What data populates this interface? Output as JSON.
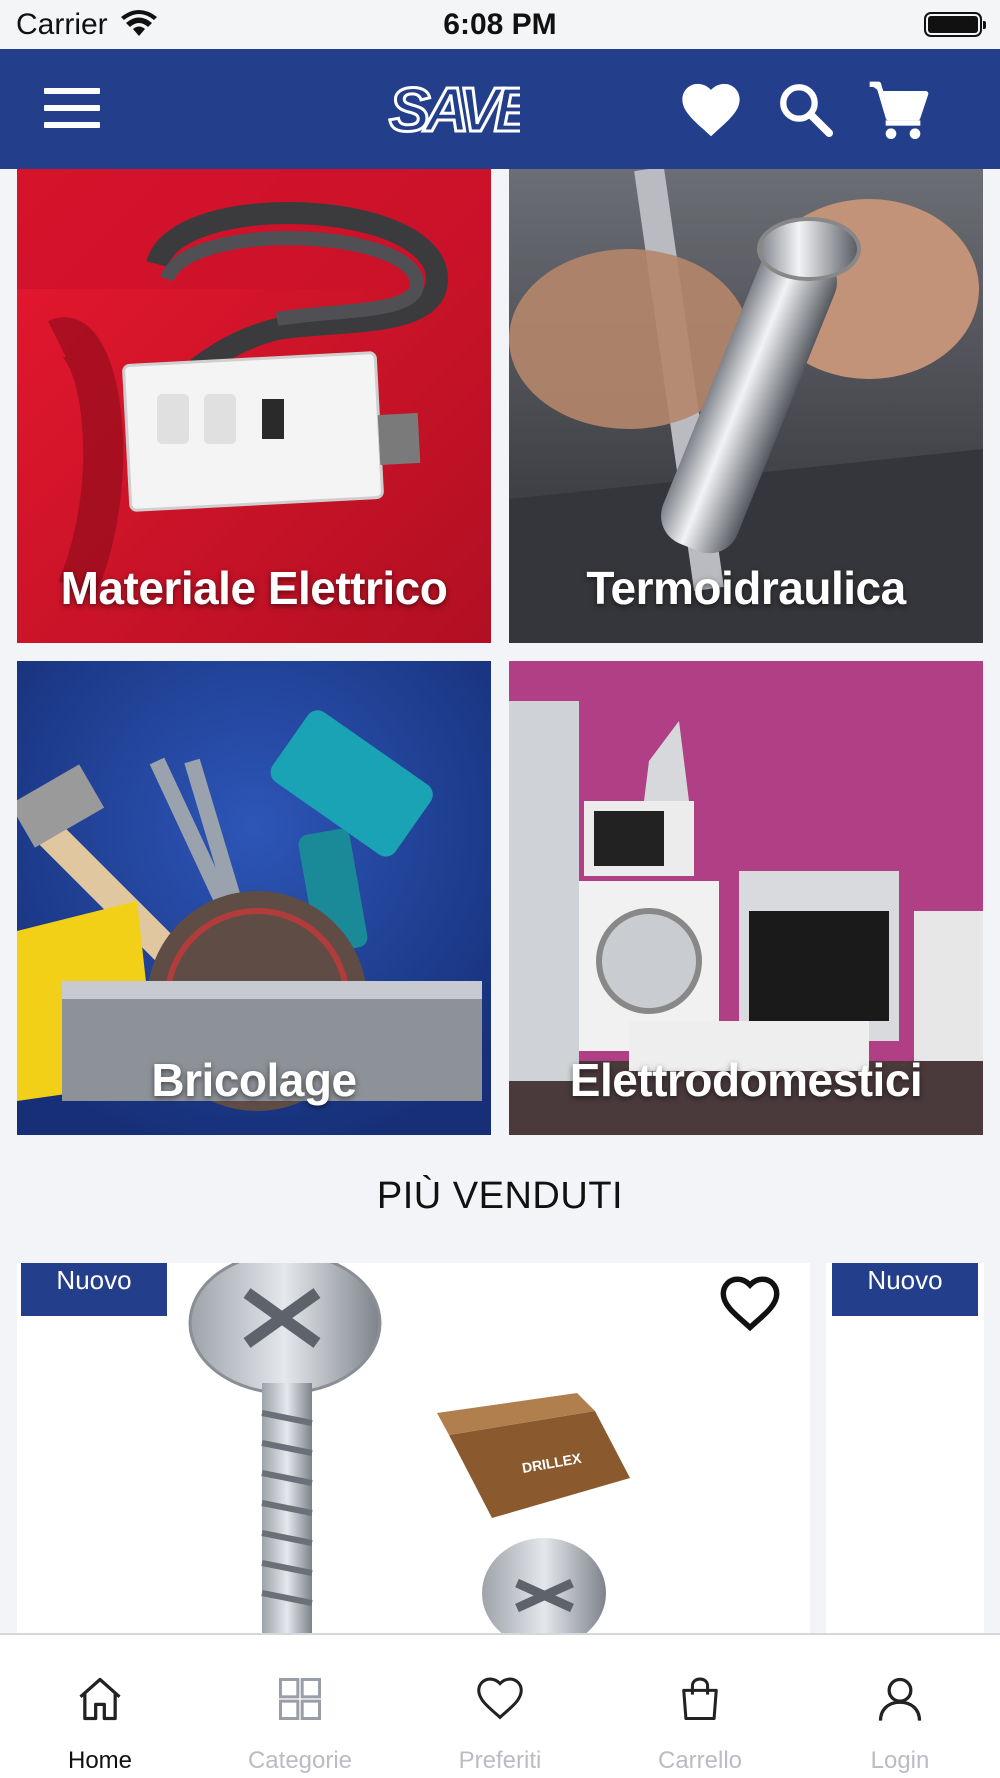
{
  "status_bar": {
    "carrier": "Carrier",
    "time": "6:08 PM"
  },
  "header": {
    "logo_text": "SAVE",
    "icons": [
      "menu-icon",
      "heart-icon",
      "search-icon",
      "cart-icon"
    ]
  },
  "categories": [
    {
      "label": "Materiale Elettrico",
      "color": "#d2142a"
    },
    {
      "label": "Termoidraulica",
      "color": "#3a3b40"
    },
    {
      "label": "Bricolage",
      "color": "#1f3d92"
    },
    {
      "label": "Elettrodomestici",
      "color": "#a8357b"
    }
  ],
  "best_sellers": {
    "title": "PIÙ VENDUTI",
    "products": [
      {
        "badge": "Nuovo",
        "box_text": "DRILLEX"
      },
      {
        "badge": "Nuovo"
      }
    ]
  },
  "tab_bar": {
    "tabs": [
      {
        "label": "Home",
        "icon": "home-icon",
        "active": true
      },
      {
        "label": "Categorie",
        "icon": "grid-icon",
        "active": false
      },
      {
        "label": "Preferiti",
        "icon": "heart-outline-icon",
        "active": false
      },
      {
        "label": "Carrello",
        "icon": "bag-icon",
        "active": false
      },
      {
        "label": "Login",
        "icon": "user-icon",
        "active": false
      }
    ]
  },
  "colors": {
    "brand": "#233e8b",
    "background": "#f2f4f7"
  }
}
